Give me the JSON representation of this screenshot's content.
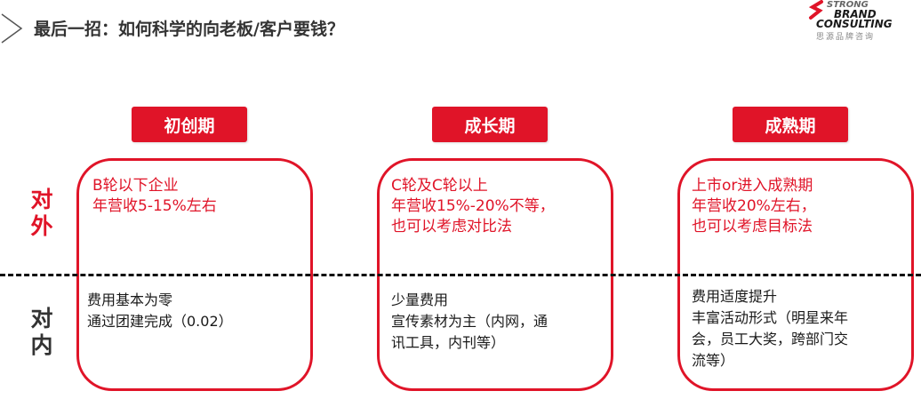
{
  "header": {
    "title": "最后一招：如何科学的向老板/客户要钱？"
  },
  "logo": {
    "line1": "STRONG",
    "line2": "BRAND",
    "line3": "CONSULTING",
    "sub": "思源品牌咨询"
  },
  "rows": {
    "external_label": "对外",
    "internal_label": "对内"
  },
  "phases": [
    {
      "label": "初创期",
      "external": [
        "B轮以下企业",
        "年营收5-15%左右"
      ],
      "internal": [
        "费用基本为零",
        "通过团建完成（0.02）"
      ]
    },
    {
      "label": "成长期",
      "external": [
        "C轮及C轮以上",
        "年营收15%-20%不等，",
        "也可以考虑对比法"
      ],
      "internal": [
        "少量费用",
        "宣传素材为主（内网，通",
        "讯工具，内刊等）"
      ]
    },
    {
      "label": "成熟期",
      "external": [
        "上市or进入成熟期",
        "年营收20%左右，",
        "也可以考虑目标法"
      ],
      "internal": [
        "费用适度提升",
        "丰富活动形式（明星来年",
        "会，员工大奖，跨部门交",
        "流等）"
      ]
    }
  ],
  "colors": {
    "accent": "#e01428",
    "text": "#1a1a1a"
  }
}
